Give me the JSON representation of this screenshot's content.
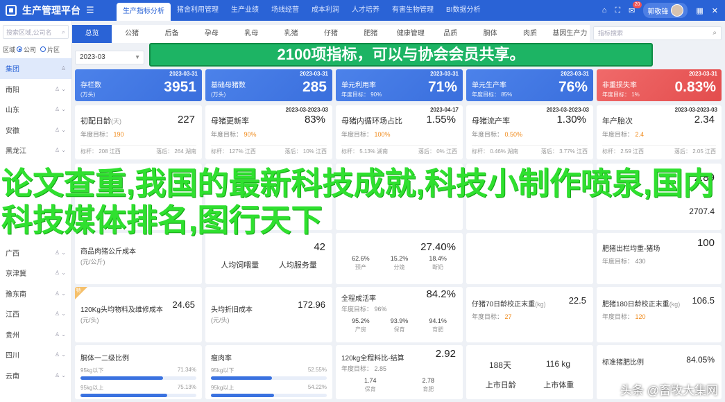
{
  "topbar": {
    "title": "生产管理平台",
    "tabs": [
      "生产指标分析",
      "猪舍利用管理",
      "生产业绩",
      "场线经营",
      "成本利润",
      "人才培养",
      "有害生物管理",
      "BI数据分析"
    ],
    "notification_count": "20",
    "user_name": "郭敬锋"
  },
  "sidebar": {
    "search_placeholder": "搜索区域,公司名",
    "radio_label": "区域",
    "radio_option1": "公司",
    "radio_option2": "片区",
    "items": [
      "集团",
      "南阳",
      "山东",
      "安徽",
      "黑龙江",
      "",
      "",
      "",
      "",
      "广西",
      "京津冀",
      "豫东南",
      "江西",
      "贵州",
      "四川",
      "云南"
    ]
  },
  "subtabs": [
    "总览",
    "公猪",
    "后备",
    "孕母",
    "乳母",
    "乳猪",
    "仔猪",
    "肥猪",
    "健康管理",
    "品质",
    "胴体",
    "肉质",
    "基因生产力"
  ],
  "search": {
    "placeholder": "指标搜索"
  },
  "date_filter": "2023-03",
  "banner": "2100项指标，可以与协会会员共享。",
  "overlay_text": "论文查重,我国的最新科技成就,科技小制作喷泉,国内科技媒体排名,图行天下",
  "watermark": "头条 @畜牧大集网",
  "kpis": [
    {
      "date": "2023-03-31",
      "title": "存栏数",
      "sub": "(万头)",
      "value": "3951"
    },
    {
      "date": "2023-03-31",
      "title": "基础母猪数",
      "sub": "(万头)",
      "value": "285"
    },
    {
      "date": "2023-03-31",
      "title": "单元利用率",
      "sub": "年度目标： 90%",
      "value": "71%"
    },
    {
      "date": "2023-03-31",
      "title": "单元生产率",
      "sub": "年度目标： 85%",
      "value": "76%"
    },
    {
      "date": "2023-03-31",
      "title": "非重损失率",
      "sub": "年度目标： 1%",
      "value": "0.83%"
    }
  ],
  "row2": [
    {
      "title": "初配日龄",
      "title_suffix": "(天)",
      "value": "227",
      "date": "",
      "target_label": "年度目标：",
      "target": "190",
      "foot_left": "标杆： 208 江西",
      "foot_right": "落后： 264 湖南"
    },
    {
      "title": "母猪更新率",
      "title_suffix": "",
      "value": "83%",
      "date": "2023-03-2023-03",
      "target_label": "年度目标：",
      "target": "90%",
      "foot_left": "标杆： 127% 江西",
      "foot_right": "落后： 10% 江西"
    },
    {
      "title": "母猪内循环场占比",
      "title_suffix": "",
      "value": "1.55%",
      "date": "2023-04-17",
      "target_label": "年度目标：",
      "target": "100%",
      "foot_left": "标杆： 5.13% 湖南",
      "foot_right": "落后： 0% 江西"
    },
    {
      "title": "母猪流产率",
      "title_suffix": "",
      "value": "1.30%",
      "date": "2023-03-2023-03",
      "target_label": "年度目标：",
      "target": "0.50%",
      "foot_left": "标杆： 0.46% 湖南",
      "foot_right": "落后： 3.77% 江西"
    },
    {
      "title": "年产胎次",
      "title_suffix": "",
      "value": "2.34",
      "date": "2023-03-2023-03",
      "target_label": "年度目标：",
      "target": "2.4",
      "foot_left": "标杆： 2.59 江西",
      "foot_right": "落后： 2.05 江西"
    }
  ],
  "row3_right": [
    {
      "value": "2.89"
    },
    {
      "value": "2707.4"
    }
  ],
  "row4": [
    {
      "title": "商品肉猪公斤成本",
      "sub": "(元/公斤)",
      "value": "",
      "date": ""
    },
    {
      "title": "",
      "sub": "",
      "value": "42",
      "labels": [
        "人均饲喂量",
        "人均服务量"
      ]
    },
    {
      "title": "",
      "sub": "",
      "value": "27.40%",
      "trio": [
        {
          "v": "62.6%",
          "l": "预产"
        },
        {
          "v": "15.2%",
          "l": "分娩"
        },
        {
          "v": "18.4%",
          "l": "断奶"
        }
      ]
    },
    {
      "title": "肥猪出栏均重-猪场",
      "sub": "年度目标： 430",
      "value": "100"
    }
  ],
  "row5": [
    {
      "tag": "特",
      "title": "120Kg头均物料及维修成本",
      "sub": "(元/头)",
      "value": "24.65"
    },
    {
      "title": "头均折旧成本",
      "sub": "(元/头)",
      "value": "172.96"
    },
    {
      "title": "全程成活率",
      "sub": "年度目标： 96%",
      "value": "84.2%",
      "trio": [
        {
          "v": "95.2%",
          "l": "产房"
        },
        {
          "v": "93.9%",
          "l": "保育"
        },
        {
          "v": "94.1%",
          "l": "育肥"
        }
      ]
    },
    {
      "title": "仔猪70日龄校正末重",
      "sub": "(kg)",
      "value": "22.5",
      "target_label": "年度目标：",
      "target": "27"
    },
    {
      "title": "肥猪180日龄校正末重",
      "sub": "(kg)",
      "value": "106.5",
      "target_label": "年度目标：",
      "target": "120"
    }
  ],
  "row6": [
    {
      "title": "胴体一二级比例",
      "bars": [
        {
          "label": "95kg以下",
          "value": "71.34%",
          "pct": 71.34
        },
        {
          "label": "95kg以上",
          "value": "75.13%",
          "pct": 75.13
        }
      ]
    },
    {
      "title": "瘦肉率",
      "bars": [
        {
          "label": "95kg以下",
          "value": "52.55%",
          "pct": 52.55
        },
        {
          "label": "95kg以上",
          "value": "54.22%",
          "pct": 54.22
        }
      ]
    },
    {
      "title": "120kg全程料比-结算",
      "value": "2.92",
      "sub": "年度目标： 2.85",
      "trio": [
        {
          "v": "1.74",
          "l": "保育"
        },
        {
          "v": "2.78",
          "l": "育肥"
        }
      ]
    },
    {
      "left_value": "188天",
      "left_label": "上市日龄",
      "right_value": "116 kg",
      "right_label": "上市体重"
    },
    {
      "title": "标准猪肥比例",
      "value": "84.05%"
    }
  ]
}
